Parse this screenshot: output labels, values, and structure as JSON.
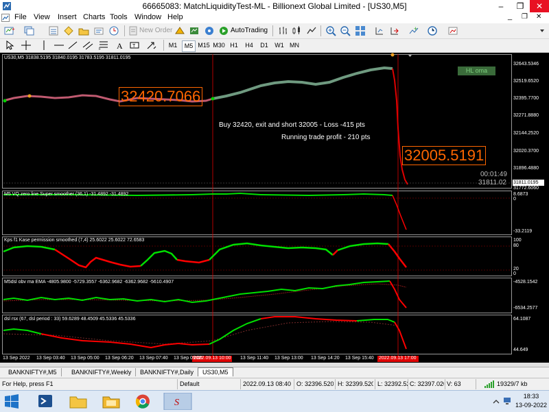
{
  "window": {
    "title": "66665083: MatchLiquidityTest-ML - Billionext Global Limited - [US30,M5]",
    "minimize": "–",
    "restore": "❐",
    "close": "✕",
    "inner_minimize": "_",
    "inner_restore": "❐",
    "inner_close": "✕"
  },
  "menu": [
    "File",
    "View",
    "Insert",
    "Charts",
    "Tools",
    "Window",
    "Help"
  ],
  "toolbar": {
    "new_order": "New Order",
    "auto_trading": "AutoTrading",
    "timeframes": [
      "M1",
      "M5",
      "M15",
      "M30",
      "H1",
      "H4",
      "D1",
      "W1",
      "MN"
    ],
    "active_timeframe": "M5"
  },
  "chart": {
    "main_label": "US30,M5  31838.5195  31840.0195  31783.5195  31811.0195",
    "hl_button": "HL oma",
    "entry_price_label": "32420.7066",
    "exit_price_label": "32005.5191",
    "annotation_1": "Buy 32420, exit and short 32005 - Loss -415 pts",
    "annotation_2": "Running trade profit - 210 pts",
    "countdown": "00:01:49",
    "last_price": "31811.02",
    "bid_box": "31811.0195",
    "main_yticks": [
      "32643.5346",
      "32519.6520",
      "32395.7700",
      "32271.8880",
      "32144.2520",
      "32020.3700",
      "31896.4880",
      "31772.6060"
    ],
    "ind1_label": "M5 VQ zero line Super smoother (36,1) -31.4892 -31.4892",
    "ind1_yticks": [
      "8.6873",
      "0",
      "-33.2119"
    ],
    "ind2_label": "Kps f1 Kase permission smoothed (7,4) 25.6022 25.6022 72.6583",
    "ind2_yticks": [
      "100",
      "80",
      "20",
      "0"
    ],
    "ind3_label": "M5dsl  obv ma  EMA  -4805.9800 -5729.3557 -6362.9682 -6362.9682 -5610.4907",
    "ind3_yticks": [
      "-4528.1542",
      "-6534.2577"
    ],
    "ind4_label": "dsl rsx (67, dsl period : 33) 59.6289 48.4509 45.5336 45.5336",
    "ind4_yticks": [
      "64.1087",
      "44.649"
    ],
    "xticks": [
      "13 Sep 2022",
      "13 Sep 03:40",
      "13 Sep 05:00",
      "13 Sep 06:20",
      "13 Sep 07:40",
      "13 Sep 09:00",
      "2022.09.13 10:00",
      "13 Sep 11:40",
      "13 Sep 13:00",
      "13 Sep 14:20",
      "13 Sep 15:40",
      "2022.09.13 17:00"
    ]
  },
  "tabs": [
    "BANKNIFTY#,M5",
    "BANKNIFTY#,Weekly",
    "BANKNIFTY#,Daily",
    "US30,M5"
  ],
  "active_tab": "US30,M5",
  "status": {
    "help": "For Help, press F1",
    "profile": "Default",
    "datetime": "2022.09.13 08:40",
    "open": "O: 32396.520",
    "high": "H: 32399.520",
    "low": "L: 32392.520",
    "close": "C: 32397.020",
    "volume": "V: 63",
    "traffic": "19329/7 kb"
  },
  "taskbar": {
    "time": "18:33",
    "date": "13-09-2022"
  },
  "colors": {
    "price_line": "#6f8f75",
    "price_down": "#e00000",
    "bull": "#00e000",
    "bear": "#ff0000",
    "price_label": "#ff6600",
    "hl_button_bg": "#3a6b3a"
  }
}
